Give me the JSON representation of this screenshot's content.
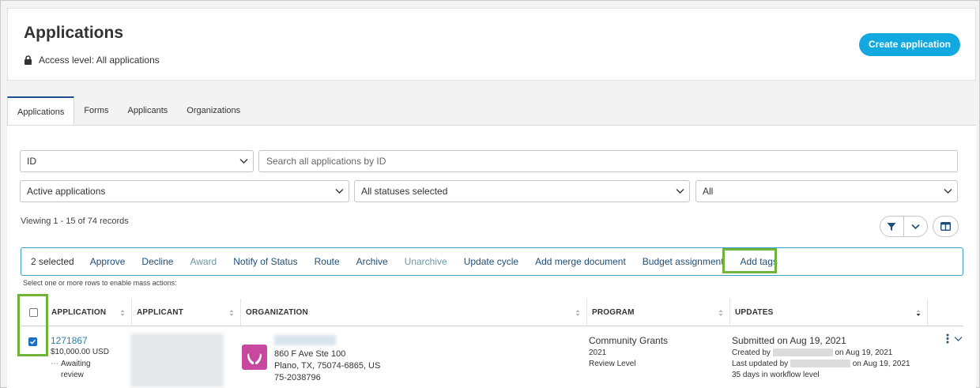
{
  "header": {
    "title": "Applications",
    "access_label": "Access level: All applications",
    "create_button": "Create application"
  },
  "tabs": [
    {
      "label": "Applications",
      "active": true
    },
    {
      "label": "Forms"
    },
    {
      "label": "Applicants"
    },
    {
      "label": "Organizations"
    }
  ],
  "filters": {
    "search_field": "ID",
    "search_placeholder": "Search all applications by ID",
    "applications_filter": "Active applications",
    "status_filter": "All statuses selected",
    "third_filter": "All"
  },
  "viewing": "Viewing 1 - 15 of 74 records",
  "mass_actions": {
    "selected": "2 selected",
    "actions": [
      "Approve",
      "Decline",
      "Award",
      "Notify of Status",
      "Route",
      "Archive",
      "Unarchive",
      "Update cycle",
      "Add merge document",
      "Budget assignment",
      "Add tags"
    ],
    "disabled": [
      "Award",
      "Unarchive"
    ],
    "hint": "Select one or more rows to enable mass actions:"
  },
  "table": {
    "columns": [
      "APPLICATION",
      "APPLICANT",
      "ORGANIZATION",
      "PROGRAM",
      "UPDATES"
    ],
    "rows": [
      {
        "id": "1271867",
        "amount": "$10,000.00 USD",
        "status_line1": "Awaiting",
        "status_line2": "review",
        "org_address1": "860 F Ave Ste 100",
        "org_address2": "Plano, TX, 75074-6865, US",
        "org_tax_id": "75-2038796",
        "program": "Community Grants",
        "program_year": "2021",
        "program_level": "Review Level",
        "submitted": "Submitted on Aug 19, 2021",
        "created_prefix": "Created by",
        "created_suffix": "on Aug 19, 2021",
        "updated_prefix": "Last updated by",
        "updated_suffix": "on Aug 19, 2021",
        "workflow": "35 days in workflow level"
      }
    ]
  },
  "colors": {
    "accent": "#12a8e0",
    "highlight": "#70b23a",
    "link": "#2f7f9e"
  }
}
